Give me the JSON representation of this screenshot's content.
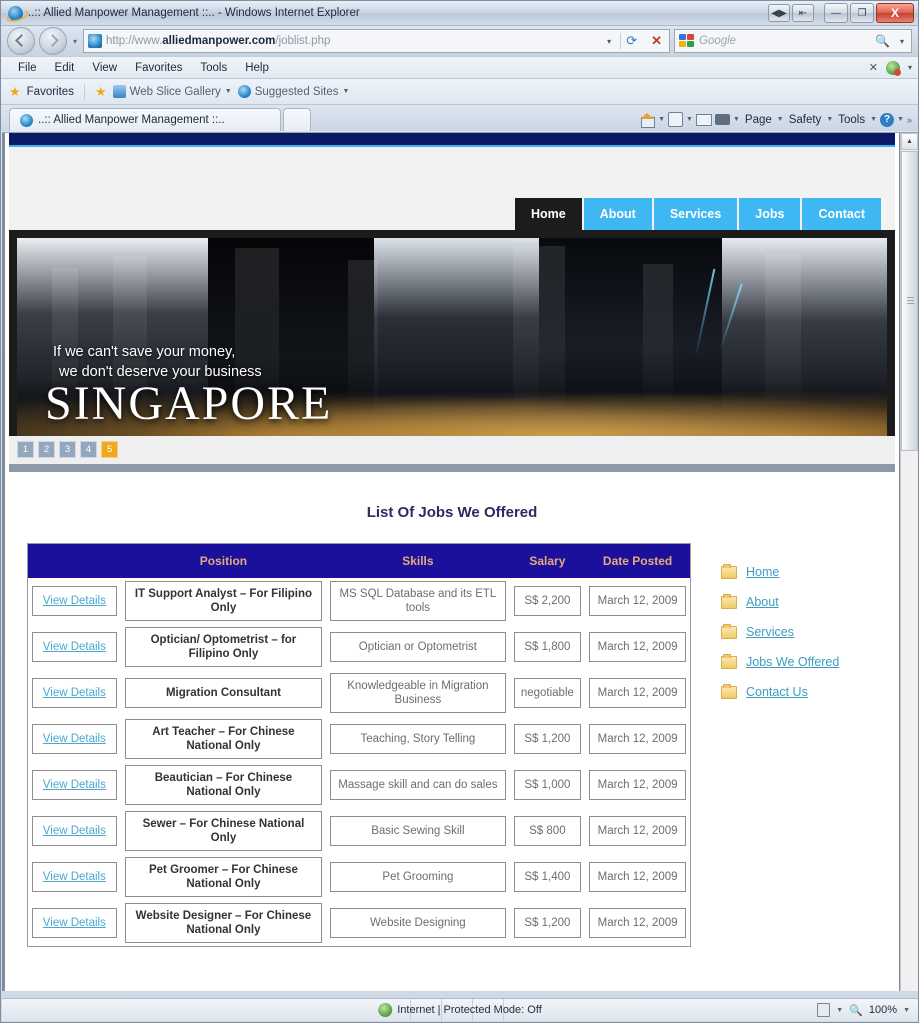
{
  "browser": {
    "window_title": "..:: Allied Manpower Management ::.. - Windows Internet Explorer",
    "window_buttons": {
      "restore_down": "◀▶",
      "prev_tab": "⇤",
      "minimize": "—",
      "maximize": "❐",
      "close": "X"
    },
    "address": {
      "protocol": "http://www.",
      "domain": "alliedmanpower.com",
      "path": "/joblist.php",
      "full": "http://www.alliedmanpower.com/joblist.php"
    },
    "search": {
      "provider": "Google",
      "placeholder": "Google"
    },
    "menu": [
      "File",
      "Edit",
      "View",
      "Favorites",
      "Tools",
      "Help"
    ],
    "favorites_bar": {
      "favorites_label": "Favorites",
      "web_slice_label": "Web Slice Gallery",
      "suggested_sites_label": "Suggested Sites"
    },
    "tab": {
      "label": "..:: Allied Manpower Management ::..",
      "new_tab_label": ""
    },
    "command_bar": [
      "Page",
      "Safety",
      "Tools"
    ],
    "status": {
      "zone": "Internet | Protected Mode: Off",
      "zoom": "100%"
    }
  },
  "site": {
    "nav": [
      {
        "label": "Home",
        "active": true
      },
      {
        "label": "About",
        "active": false
      },
      {
        "label": "Services",
        "active": false
      },
      {
        "label": "Jobs",
        "active": false
      },
      {
        "label": "Contact",
        "active": false
      }
    ],
    "hero": {
      "caption_line1": "If we can't save your money,",
      "caption_line2": "we don't deserve your business",
      "title": "SINGAPORE",
      "pager": [
        "1",
        "2",
        "3",
        "4",
        "5"
      ],
      "pager_active_index": 4
    },
    "page_title": "List Of Jobs We Offered",
    "table": {
      "columns": [
        "",
        "Position",
        "Skills",
        "Salary",
        "Date Posted"
      ],
      "view_label": "View Details",
      "rows": [
        {
          "position": "IT Support Analyst – For Filipino Only",
          "skills": "MS SQL Database and its ETL tools",
          "salary": "S$ 2,200",
          "date": "March 12, 2009"
        },
        {
          "position": "Optician/ Optometrist – for Filipino Only",
          "skills": "Optician or Optometrist",
          "salary": "S$ 1,800",
          "date": "March 12, 2009"
        },
        {
          "position": "Migration Consultant",
          "skills": "Knowledgeable in Migration Business",
          "salary": "negotiable",
          "date": "March 12, 2009"
        },
        {
          "position": "Art Teacher – For Chinese National Only",
          "skills": "Teaching, Story Telling",
          "salary": "S$ 1,200",
          "date": "March 12, 2009"
        },
        {
          "position": "Beautician – For Chinese National Only",
          "skills": "Massage skill and can do sales",
          "salary": "S$ 1,000",
          "date": "March 12, 2009"
        },
        {
          "position": "Sewer – For Chinese National Only",
          "skills": "Basic Sewing Skill",
          "salary": "S$ 800",
          "date": "March 12, 2009"
        },
        {
          "position": "Pet Groomer – For Chinese National Only",
          "skills": "Pet Grooming",
          "salary": "S$ 1,400",
          "date": "March 12, 2009"
        },
        {
          "position": "Website Designer – For Chinese National Only",
          "skills": "Website Designing",
          "salary": "S$ 1,200",
          "date": "March 12, 2009"
        }
      ]
    },
    "sidebar_links": [
      "Home",
      "About",
      "Services",
      "Jobs We Offered",
      "Contact Us"
    ]
  },
  "colors": {
    "nav_active": "#1c1c1c",
    "nav_link": "#3fb7f2",
    "table_header_bg": "#1a109b",
    "table_header_text": "#e8a87c",
    "title_text": "#2b2a63",
    "link": "#3d9dbf",
    "top_bar": "#0b1a66",
    "accent_line": "#39b6f0",
    "pager_active": "#f0a81e"
  }
}
